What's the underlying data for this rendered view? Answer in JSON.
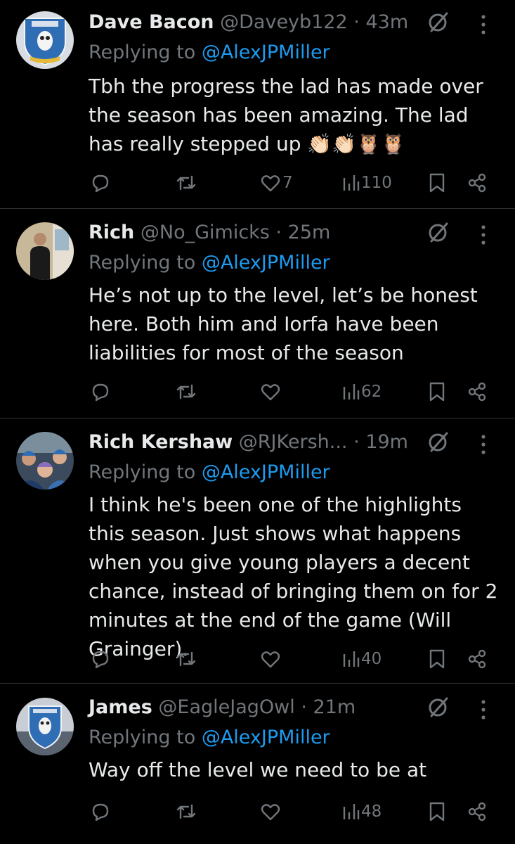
{
  "icons": {
    "reply": "reply-icon",
    "repost": "repost-icon",
    "like": "heart-icon",
    "views": "views-icon",
    "bookmark": "bookmark-icon",
    "share": "share-icon",
    "grok": "grok-icon",
    "more": "more-icon"
  },
  "colors": {
    "background": "#000000",
    "text": "#e7e9ea",
    "muted": "#71767b",
    "link": "#1d9bf0",
    "divider": "#2f3336"
  },
  "tweets": [
    {
      "name": "Dave Bacon",
      "handle": "@Daveyb122",
      "separator": "·",
      "time": "43m",
      "replying_prefix": "Replying to",
      "replying_to": "@AlexJPMiller",
      "text": "Tbh the progress the lad has made over the season has been amazing. The lad has really stepped up 👏🏻👏🏻🦉🦉",
      "likes": "7",
      "views": "110",
      "avatar": "club-crest-avatar"
    },
    {
      "name": "Rich",
      "handle": "@No_Gimicks",
      "separator": "·",
      "time": "25m",
      "replying_prefix": "Replying to",
      "replying_to": "@AlexJPMiller",
      "text": "He’s not up to the level, let’s be honest here. Both him and Iorfa have been liabilities for most of the season",
      "likes": "",
      "views": "62",
      "avatar": "person-photo-avatar"
    },
    {
      "name": "Rich Kershaw",
      "handle": "@RJKersh...",
      "separator": "·",
      "time": "19m",
      "replying_prefix": "Replying to",
      "replying_to": "@AlexJPMiller",
      "text": "I think he's been one of the highlights this season. Just shows what happens when you give young players a decent chance, instead of bringing them on for 2 minutes at the end of the game (Will Grainger).",
      "likes": "",
      "views": "40",
      "avatar": "family-photo-avatar"
    },
    {
      "name": "James",
      "handle": "@EagleJagOwl",
      "separator": "·",
      "time": "21m",
      "replying_prefix": "Replying to",
      "replying_to": "@AlexJPMiller",
      "text": "Way off the level we need to be at",
      "likes": "",
      "views": "48",
      "avatar": "crest-sign-avatar"
    }
  ]
}
